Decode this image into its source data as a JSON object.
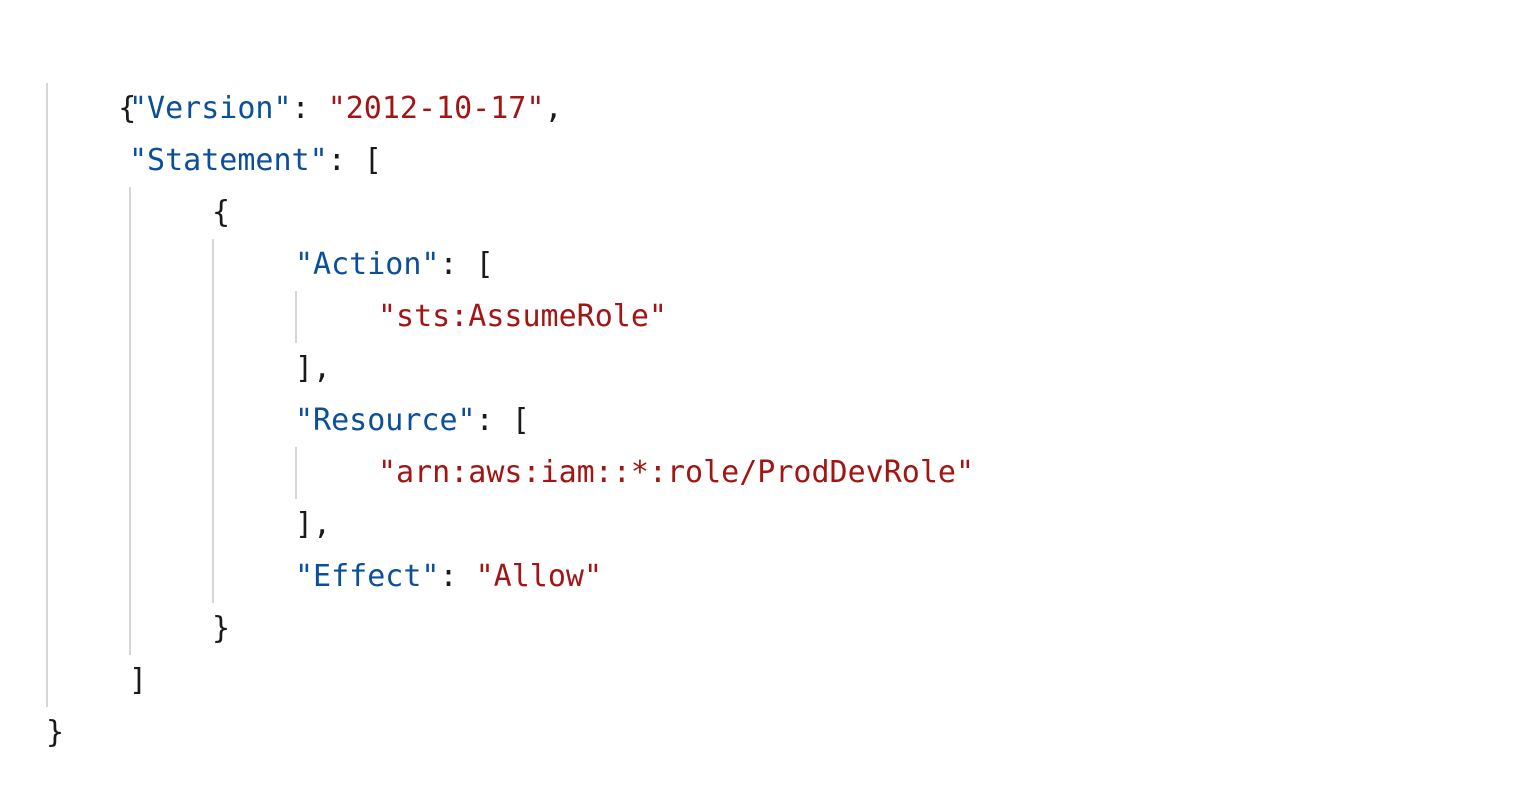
{
  "json_viewer": {
    "open_brace": "{",
    "close_brace": "}",
    "colon": ":",
    "comma": ",",
    "open_bracket": "[",
    "close_bracket": "]",
    "bracket_close_comma": "],",
    "version_key": "\"Version\"",
    "version_value": "\"2012-10-17\"",
    "statement_key": "\"Statement\"",
    "action_key": "\"Action\"",
    "action_value": "\"sts:AssumeRole\"",
    "resource_key": "\"Resource\"",
    "resource_value": "\"arn:aws:iam::*:role/ProdDevRole\"",
    "effect_key": "\"Effect\"",
    "effect_value": "\"Allow\""
  },
  "colors": {
    "key": "#0b4f9c",
    "string": "#a31515",
    "punctuation": "#1a1a1a",
    "guide": "#d6d6d6"
  }
}
